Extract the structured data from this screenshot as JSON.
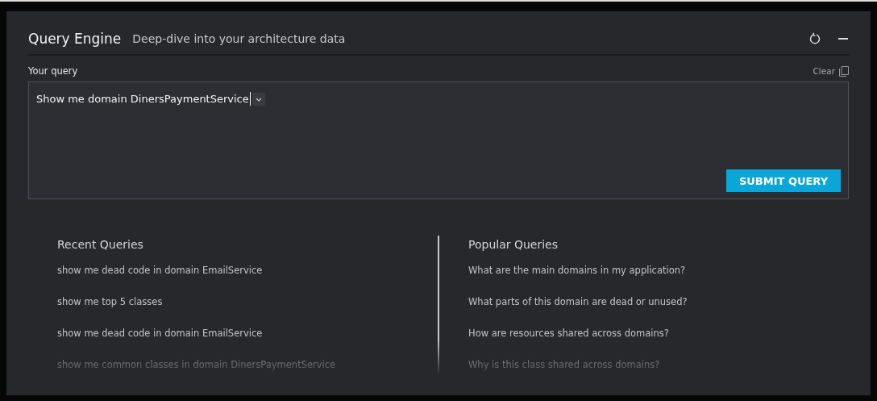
{
  "header": {
    "title": "Query Engine",
    "subtitle": "Deep-dive into your architecture data"
  },
  "query": {
    "label": "Your query",
    "clear": "Clear",
    "value": "Show me domain DinersPaymentService",
    "submit": "SUBMIT QUERY"
  },
  "recent": {
    "title": "Recent Queries",
    "items": [
      "show me dead code in domain EmailService",
      "show me top 5 classes",
      "show me dead code in domain EmailService",
      "show me common classes in domain DinersPaymentService"
    ]
  },
  "popular": {
    "title": "Popular Queries",
    "items": [
      "What are the main domains in my application?",
      "What parts of this domain are dead or unused?",
      "How are resources shared across domains?",
      "Why is this class shared across domains?"
    ]
  }
}
